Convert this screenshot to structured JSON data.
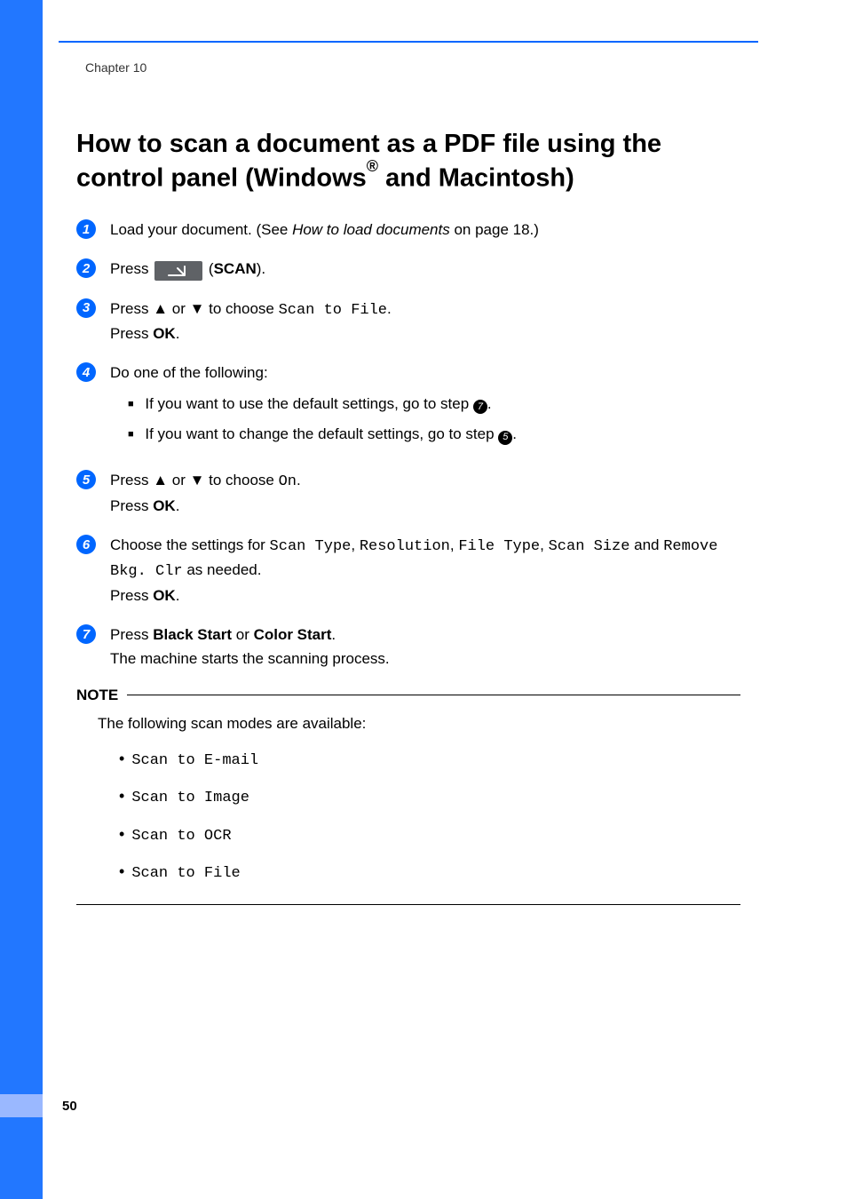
{
  "chapter": "Chapter 10",
  "title_1": "How to scan a document as a PDF file using the control panel (Windows",
  "title_reg": "®",
  "title_2": " and Macintosh)",
  "steps": {
    "s1": {
      "t1": "Load your document. (See ",
      "italic": "How to load documents",
      "t2": " on page 18.)"
    },
    "s2": {
      "t1": "Press ",
      "scan": "SCAN",
      "t2": ")."
    },
    "s3": {
      "t1": "Press ",
      "arrow_up": "▲",
      "or": " or ",
      "arrow_dn": "▼",
      "t2": " to choose ",
      "mono": "Scan to File",
      "dot": ".",
      "t3": "Press ",
      "ok": "OK",
      "dot2": "."
    },
    "s4": {
      "t1": "Do one of the following:",
      "b1a": "If you want to use the default settings, go to step ",
      "b1n": "7",
      "b1d": ".",
      "b2a": "If you want to change the default settings, go to step ",
      "b2n": "5",
      "b2d": "."
    },
    "s5": {
      "t1": "Press ",
      "arrow_up": "▲",
      "or": " or ",
      "arrow_dn": "▼",
      "t2": " to choose ",
      "mono": "On",
      "dot": ".",
      "t3": "Press ",
      "ok": "OK",
      "dot2": "."
    },
    "s6": {
      "t1": "Choose the settings for ",
      "m1": "Scan Type",
      "c1": ", ",
      "m2": "Resolution",
      "c2": ", ",
      "m3": "File Type",
      "c3": ", ",
      "m4": "Scan Size",
      "and": " and ",
      "m5": "Remove Bkg. Clr",
      "t2": " as needed.",
      "t3": "Press ",
      "ok": "OK",
      "dot": "."
    },
    "s7": {
      "t1": "Press ",
      "b1": "Black Start",
      "or": " or ",
      "b2": "Color Start",
      "dot": ".",
      "t2": "The machine starts the scanning process."
    }
  },
  "note": {
    "label": "NOTE",
    "intro": "The following scan modes are available:",
    "items": {
      "i1": "Scan to E-mail",
      "i2": "Scan to Image",
      "i3": "Scan to OCR",
      "i4": "Scan to File"
    }
  },
  "page_number": "50"
}
